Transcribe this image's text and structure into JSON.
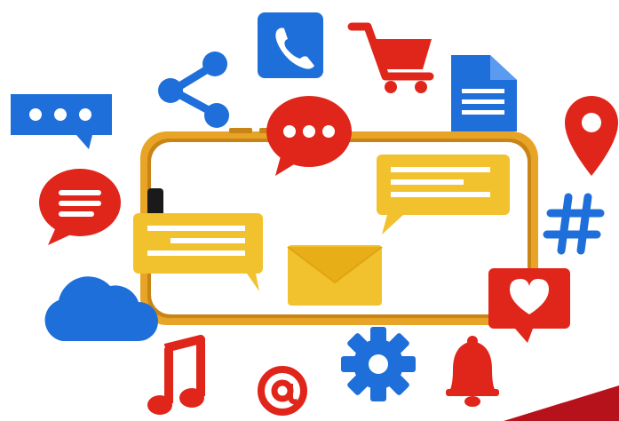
{
  "illustration": {
    "theme": "social media communication",
    "phone": {
      "orientation": "landscape",
      "frame_color": "#E8A426",
      "screen_color": "#FFFFFF"
    },
    "colors": {
      "blue": "#1E6FD9",
      "red": "#E0261B",
      "yellow": "#F2C12E",
      "dark_corner": "#B5121B"
    },
    "icons": [
      "chat-bubble-dots-icon",
      "share-icon",
      "phone-call-icon",
      "shopping-cart-icon",
      "document-icon",
      "location-pin-icon",
      "red-chat-bubble-dots-icon",
      "red-chat-bubble-lines-icon",
      "yellow-chat-bubble-left-icon",
      "yellow-chat-bubble-right-icon",
      "envelope-icon",
      "hashtag-icon",
      "heart-bubble-icon",
      "cloud-icon",
      "music-note-icon",
      "at-sign-icon",
      "gear-icon",
      "bell-icon"
    ]
  }
}
